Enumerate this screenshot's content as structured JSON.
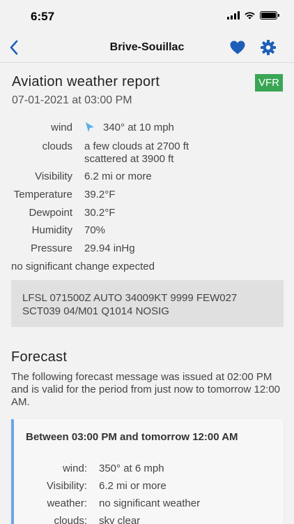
{
  "status_bar": {
    "time": "6:57"
  },
  "nav": {
    "title": "Brive-Souillac",
    "back_icon": "chevron-left-icon",
    "favorite_icon": "heart-icon",
    "settings_icon": "gear-icon"
  },
  "colors": {
    "accent": "#1d5fb8",
    "vfr": "#3aa655",
    "forecast_bar": "#6aa7e6",
    "wind_arrow": "#5aaee8"
  },
  "report": {
    "title": "Aviation weather report",
    "badge": "VFR",
    "date": "07-01-2021 at 03:00 PM",
    "rows": [
      {
        "label": "wind",
        "value": "340° at 10 mph"
      },
      {
        "label": "clouds",
        "value": "a few clouds at 2700 ft",
        "value2": "scattered at 3900 ft"
      },
      {
        "label": "Visibility",
        "value": "6.2 mi or more"
      },
      {
        "label": "Temperature",
        "value": "39.2°F"
      },
      {
        "label": "Dewpoint",
        "value": "30.2°F"
      },
      {
        "label": "Humidity",
        "value": "70%"
      },
      {
        "label": "Pressure",
        "value": "29.94 inHg"
      }
    ],
    "note": "no significant change expected",
    "metar_line1": "LFSL 071500Z AUTO 34009KT 9999 FEW027",
    "metar_line2": "SCT039 04/M01 Q1014 NOSIG"
  },
  "forecast": {
    "heading": "Forecast",
    "description": "The following forecast message was issued at 02:00 PM and is valid for the period from just now to tomorrow 12:00 AM.",
    "period": {
      "title": "Between 03:00 PM and tomorrow 12:00 AM",
      "rows": [
        {
          "label": "wind:",
          "value": "350° at 6 mph"
        },
        {
          "label": "Visibility:",
          "value": "6.2 mi or more"
        },
        {
          "label": "weather:",
          "value": "no significant weather"
        },
        {
          "label": "clouds:",
          "value": "sky clear"
        }
      ]
    }
  }
}
